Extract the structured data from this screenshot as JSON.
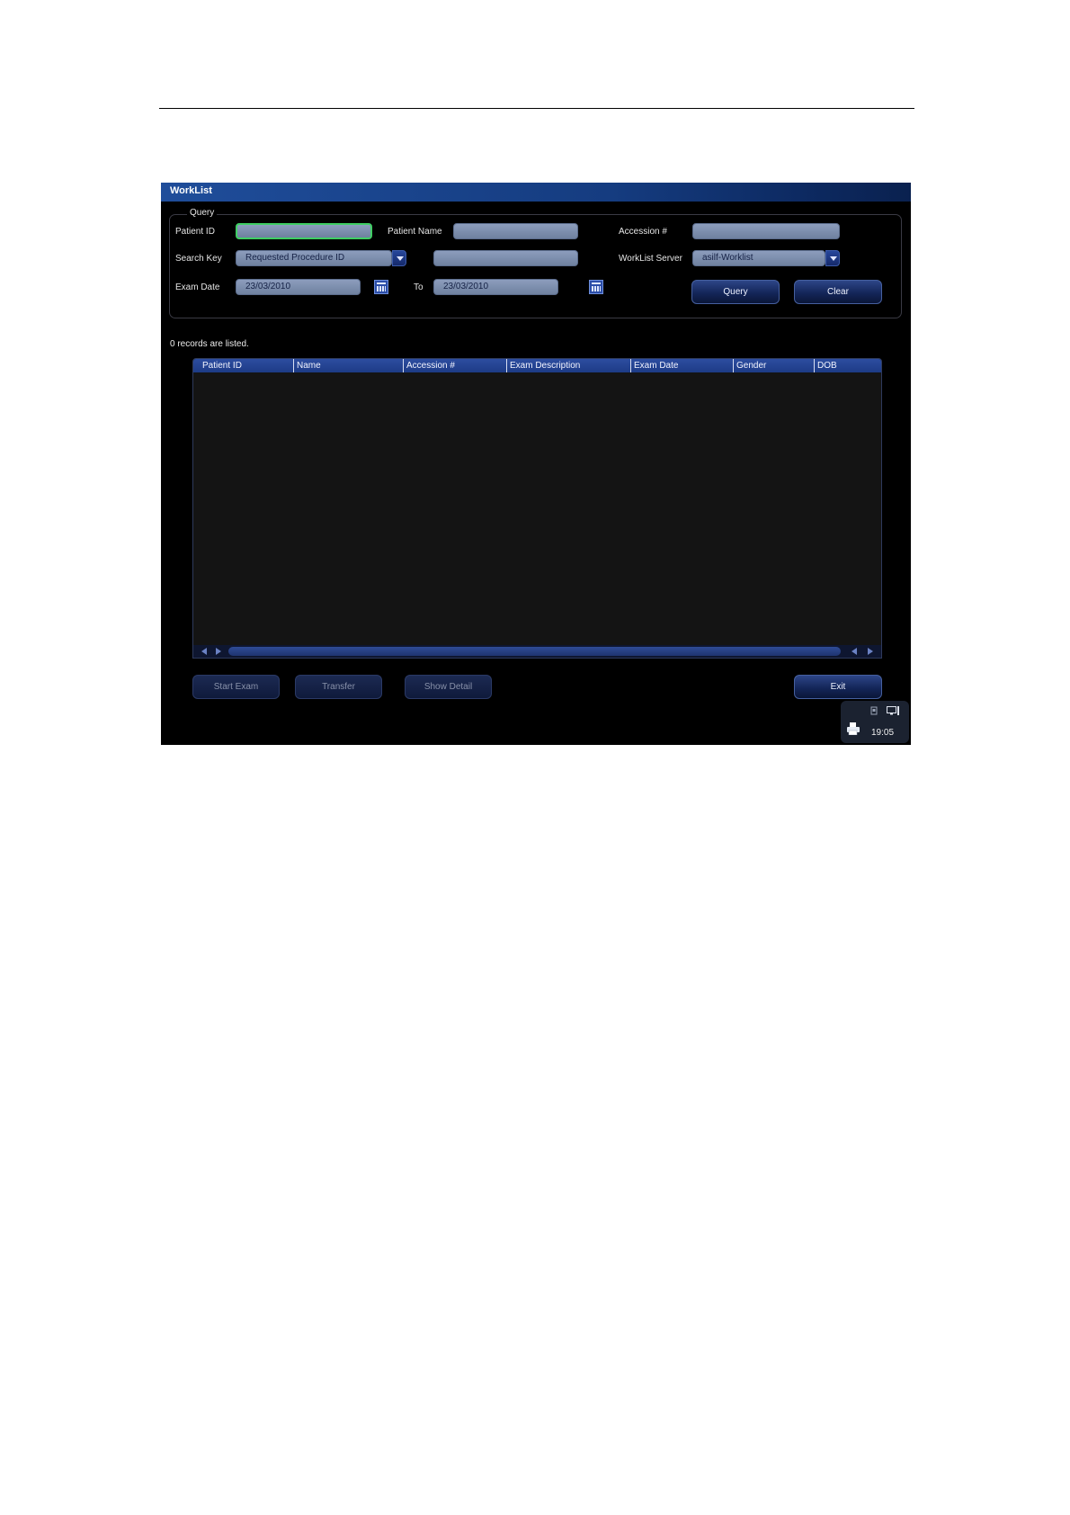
{
  "window": {
    "title": "WorkList"
  },
  "query": {
    "legend": "Query",
    "patient_id_label": "Patient ID",
    "patient_id_value": "",
    "patient_name_label": "Patient Name",
    "patient_name_value": "",
    "accession_label": "Accession #",
    "accession_value": "",
    "search_key_label": "Search Key",
    "search_key_value": "Requested Procedure ID",
    "search_text_value": "",
    "worklist_server_label": "WorkList Server",
    "worklist_server_value": "asilf-Worklist",
    "exam_date_label": "Exam Date",
    "exam_date_from": "23/03/2010",
    "to_label": "To",
    "exam_date_to": "23/03/2010",
    "query_button": "Query",
    "clear_button": "Clear"
  },
  "results": {
    "status": "0 records are listed.",
    "columns": [
      "Patient ID",
      "Name",
      "Accession #",
      "Exam Description",
      "Exam Date",
      "Gender",
      "DOB"
    ],
    "rows": []
  },
  "actions": {
    "start_exam": "Start Exam",
    "transfer": "Transfer",
    "show_detail": "Show Detail",
    "exit": "Exit"
  },
  "tray": {
    "time": "19:05"
  },
  "colors": {
    "title_bar": "#1f4d9a",
    "focus_border": "#3fce63",
    "header": "#2d4da0"
  }
}
